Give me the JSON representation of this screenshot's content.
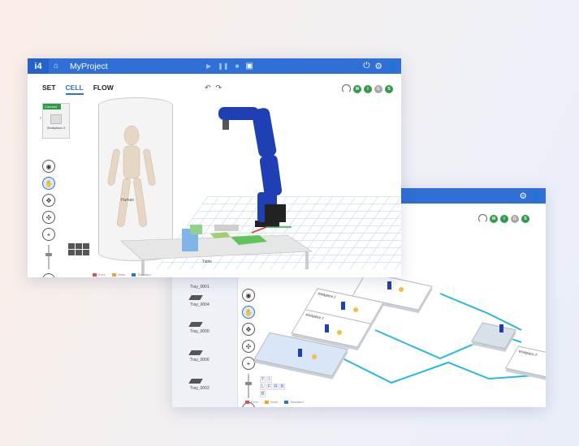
{
  "window1": {
    "logo": "i4",
    "title": "MyProject",
    "tabs": [
      {
        "label": "SET",
        "active": false
      },
      {
        "label": "CELL",
        "active": true
      },
      {
        "label": "FLOW",
        "active": false
      }
    ],
    "sidebar_card": {
      "tag": "Connect",
      "label": "Workplace 0"
    },
    "scene_labels": {
      "human": "Human",
      "table": "Table"
    },
    "status_dots": [
      "M",
      "I",
      "G",
      "S"
    ],
    "legend": [
      {
        "label": "Error",
        "color": "#e05050"
      },
      {
        "label": "Node",
        "color": "#f0a030"
      },
      {
        "label": "Standard",
        "color": "#2f6fd6"
      }
    ]
  },
  "window2": {
    "status_dots": [
      "M",
      "I",
      "G",
      "S"
    ],
    "trays": [
      "Tray_0001",
      "Tray_0004",
      "Tray_0000",
      "Tray_0006",
      "Tray_0002"
    ],
    "workplaces": [
      "Workplace 1",
      "Workplace 2",
      "Workplace 3",
      "Workplace 4"
    ],
    "lfrb": [
      "T",
      "I",
      "",
      "",
      "L",
      "F",
      "R",
      "B",
      "B",
      "",
      "",
      ""
    ],
    "legend": [
      {
        "label": "Error",
        "color": "#e05050"
      },
      {
        "label": "Node",
        "color": "#f0a030"
      },
      {
        "label": "Standard",
        "color": "#2f6fd6"
      }
    ]
  },
  "colors": {
    "accent": "#2f6fd6",
    "status_green": "#2e9b49",
    "conveyor": "#27b8e0",
    "robot": "#1f3fb5"
  }
}
